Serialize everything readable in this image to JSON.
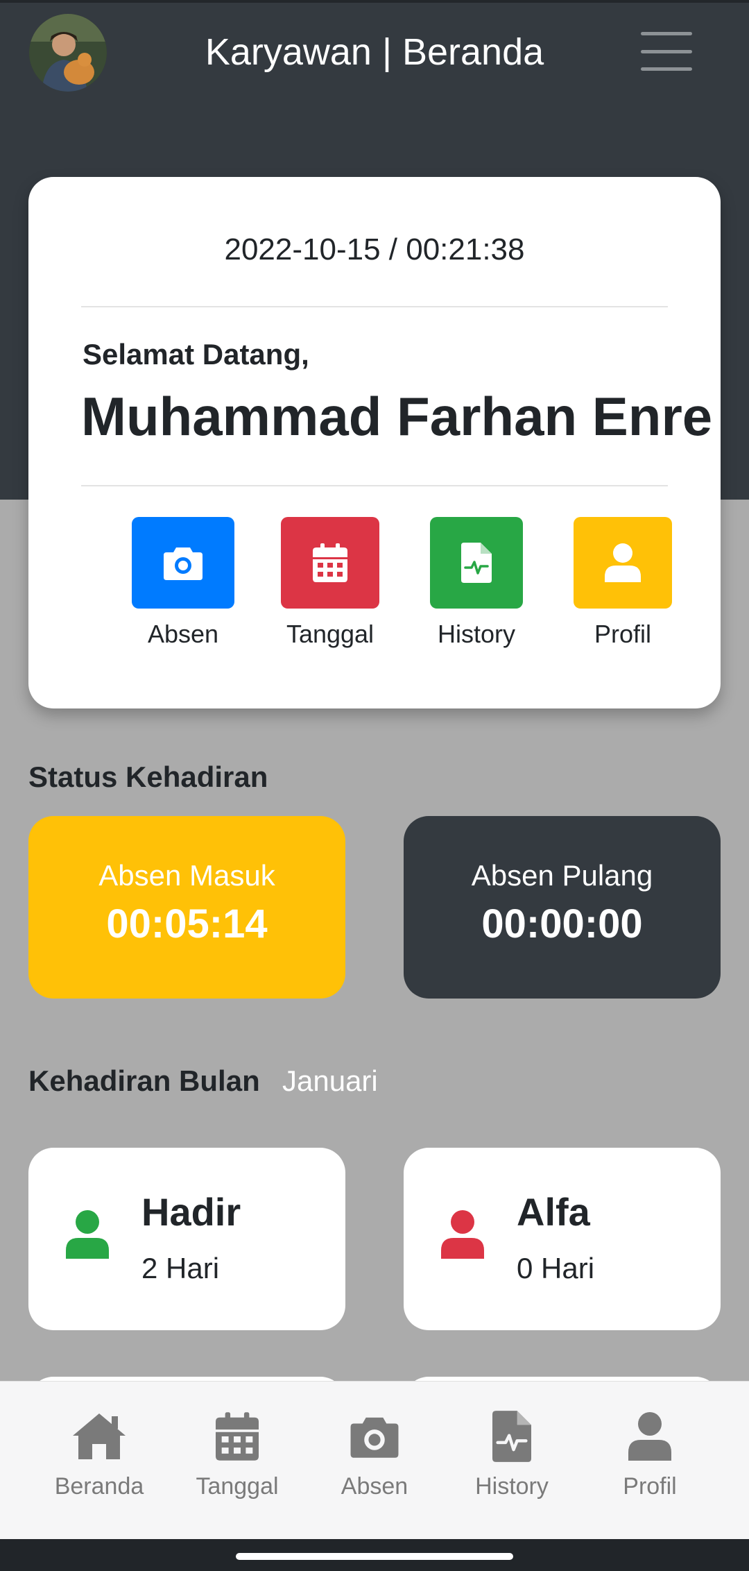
{
  "header": {
    "title": "Karyawan | Beranda"
  },
  "welcome": {
    "datetime": "2022-10-15 / 00:21:38",
    "greeting": "Selamat Datang,",
    "name": "Muhammad Farhan Enre"
  },
  "quick_actions": [
    {
      "label": "Absen",
      "icon": "camera-icon",
      "color": "#007bff"
    },
    {
      "label": "Tanggal",
      "icon": "calendar-icon",
      "color": "#dc3545"
    },
    {
      "label": "History",
      "icon": "medical-file-icon",
      "color": "#28a745"
    },
    {
      "label": "Profil",
      "icon": "user-icon",
      "color": "#ffc107"
    }
  ],
  "status": {
    "title": "Status Kehadiran",
    "masuk": {
      "label": "Absen Masuk",
      "time": "00:05:14",
      "color": "#ffc107"
    },
    "pulang": {
      "label": "Absen Pulang",
      "time": "00:00:00",
      "color": "#343a40"
    }
  },
  "attendance": {
    "title": "Kehadiran Bulan",
    "month": "Januari",
    "cards": [
      {
        "title": "Hadir",
        "value": "2 Hari",
        "icon": "user-icon",
        "color": "#28a745"
      },
      {
        "title": "Alfa",
        "value": "0 Hari",
        "icon": "user-icon",
        "color": "#dc3545"
      }
    ]
  },
  "bottom_nav": [
    {
      "label": "Beranda",
      "icon": "home-icon"
    },
    {
      "label": "Tanggal",
      "icon": "calendar-icon"
    },
    {
      "label": "Absen",
      "icon": "camera-icon"
    },
    {
      "label": "History",
      "icon": "medical-file-icon"
    },
    {
      "label": "Profil",
      "icon": "user-icon"
    }
  ],
  "colors": {
    "header_bg": "#343a40",
    "page_bg": "#ababab",
    "nav_icon": "#7a7a7a"
  }
}
